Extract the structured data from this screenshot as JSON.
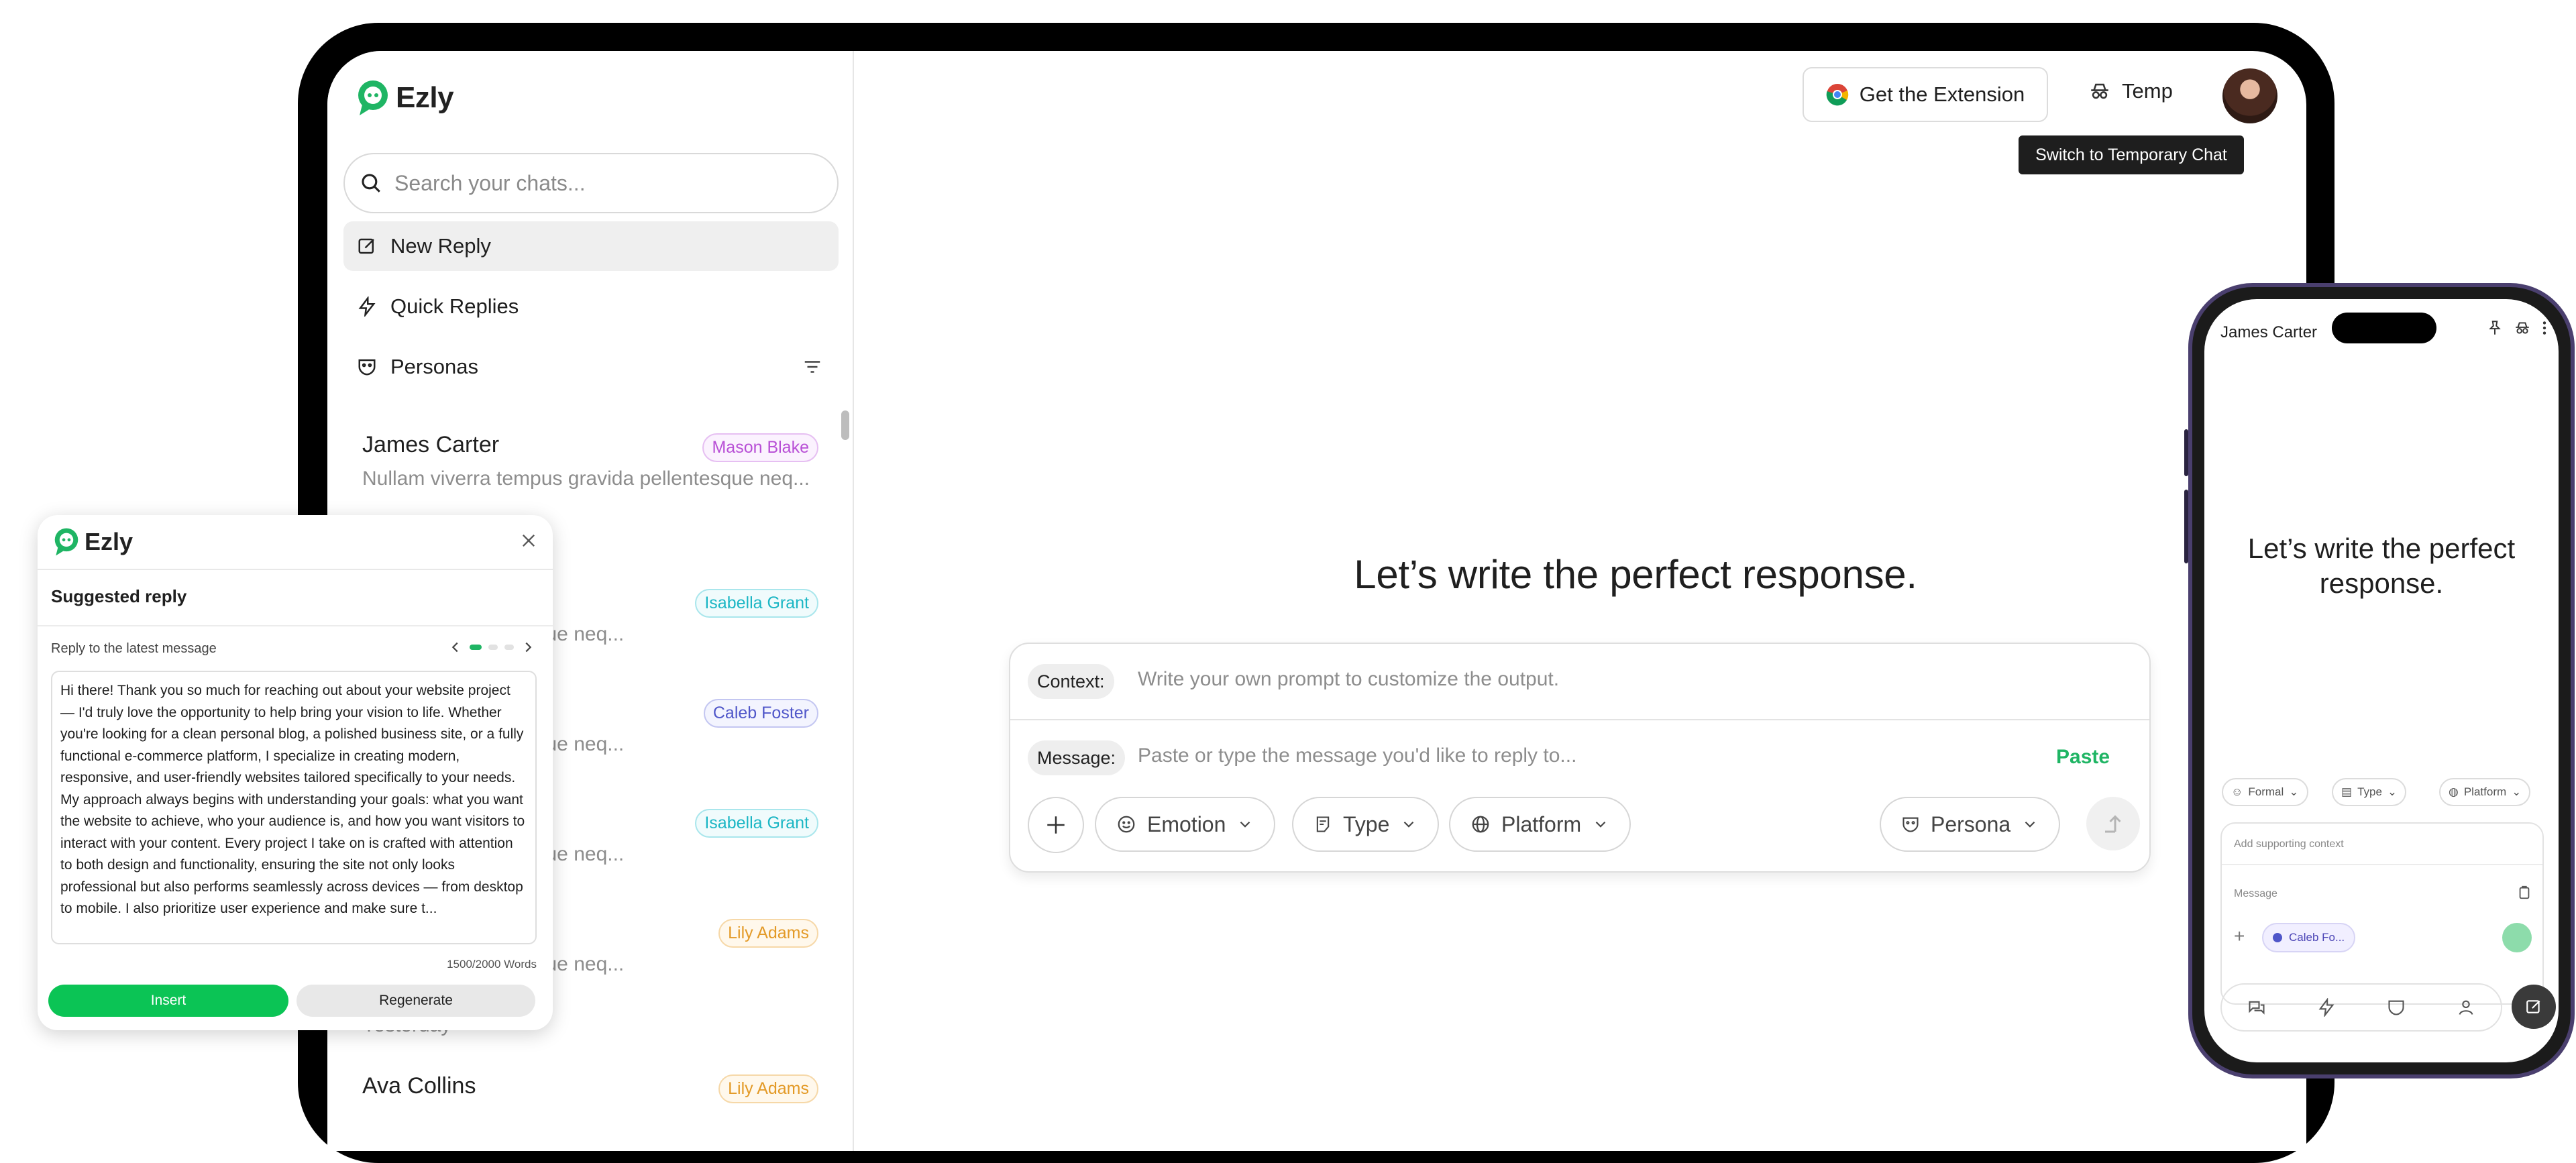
{
  "brand": {
    "name": "Ezly",
    "accent": "#1fb564"
  },
  "sidebar": {
    "search_placeholder": "Search your chats...",
    "nav": [
      {
        "label": "New Reply",
        "icon": "edit-icon"
      },
      {
        "label": "Quick Replies",
        "icon": "lightning-icon"
      },
      {
        "label": "Personas",
        "icon": "mask-icon"
      }
    ],
    "chats": [
      {
        "name": "James Carter",
        "preview": "Nullam viverra tempus gravida pellentesque neq...",
        "badge": "Mason Blake",
        "badge_color": "#b84fd6"
      },
      {
        "preview": "is gravida pellentesque neq...",
        "badge": "Isabella Grant",
        "badge_color": "#1bb6c4"
      },
      {
        "preview": "is gravida pellentesque neq...",
        "badge": "Caleb Foster",
        "badge_color": "#4f56c9"
      },
      {
        "preview": "is gravida pellentesque neq...",
        "badge": "Isabella Grant",
        "badge_color": "#1bb6c4"
      },
      {
        "preview": "is gravida pellentesque neq...",
        "badge": "Lily Adams",
        "badge_color": "#e39a27"
      },
      {
        "name": "Ava Collins",
        "badge": "Lily Adams",
        "badge_color": "#e39a27"
      }
    ],
    "partial_text": "Yesterday"
  },
  "header": {
    "extension_label": "Get the Extension",
    "temp_label": "Temp",
    "tooltip": "Switch to Temporary Chat"
  },
  "main": {
    "headline": "Let’s write the perfect response.",
    "composer": {
      "context_label": "Context:",
      "context_placeholder": "Write your own prompt to customize the output.",
      "message_label": "Message:",
      "message_placeholder": "Paste or type the message you'd like to reply to...",
      "paste_label": "Paste",
      "chips": [
        "Emotion",
        "Type",
        "Platform"
      ],
      "persona_label": "Persona"
    }
  },
  "popup": {
    "brand": "Ezly",
    "title": "Suggested reply",
    "subtitle": "Reply to the latest message",
    "body": "Hi there! Thank you so much for reaching out about your website project — I'd truly love the opportunity to help bring your vision to life. Whether you're looking for a clean personal blog, a polished business site, or a fully functional e-commerce platform, I specialize in creating modern, responsive, and user-friendly websites tailored specifically to your needs. My approach always begins with understanding your goals: what you want the website to achieve, who your audience is, and how you want visitors to interact with your content. Every project I take on is crafted with attention to both design and functionality, ensuring the site not only looks professional but also performs seamlessly across devices — from desktop to mobile. I also prioritize user experience and make sure t...",
    "word_count": "1500/2000 Words",
    "insert_label": "Insert",
    "regenerate_label": "Regenerate"
  },
  "phone": {
    "contact_name": "James Carter",
    "headline": "Let’s write the perfect response.",
    "chips": [
      "Formal",
      "Type",
      "Platform"
    ],
    "context_placeholder": "Add supporting context",
    "message_placeholder": "Message",
    "persona_tag": "Caleb Fo..."
  }
}
